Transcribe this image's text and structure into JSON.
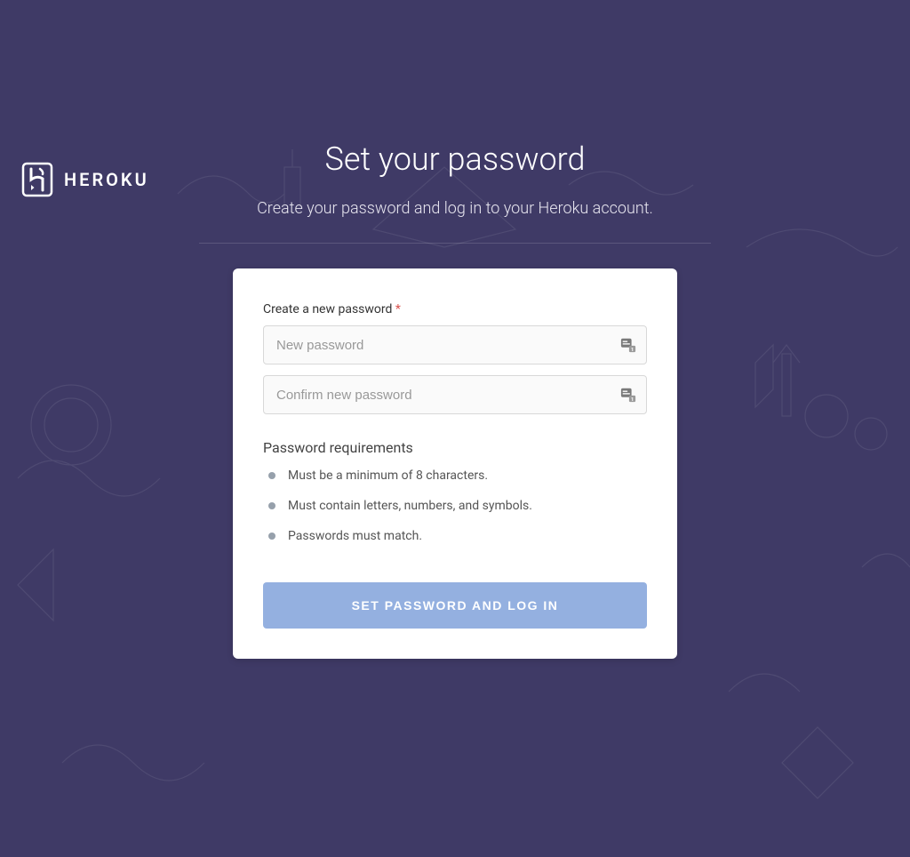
{
  "brand": {
    "name": "HEROKU"
  },
  "header": {
    "title": "Set your password",
    "subtitle": "Create your password and log in to your Heroku account."
  },
  "form": {
    "label": "Create a new password",
    "required_mark": "*",
    "new_password_placeholder": "New password",
    "confirm_password_placeholder": "Confirm new password",
    "submit_label": "SET PASSWORD AND LOG IN"
  },
  "requirements": {
    "title": "Password requirements",
    "items": [
      "Must be a minimum of 8 characters.",
      "Must contain letters, numbers, and symbols.",
      "Passwords must match."
    ]
  }
}
